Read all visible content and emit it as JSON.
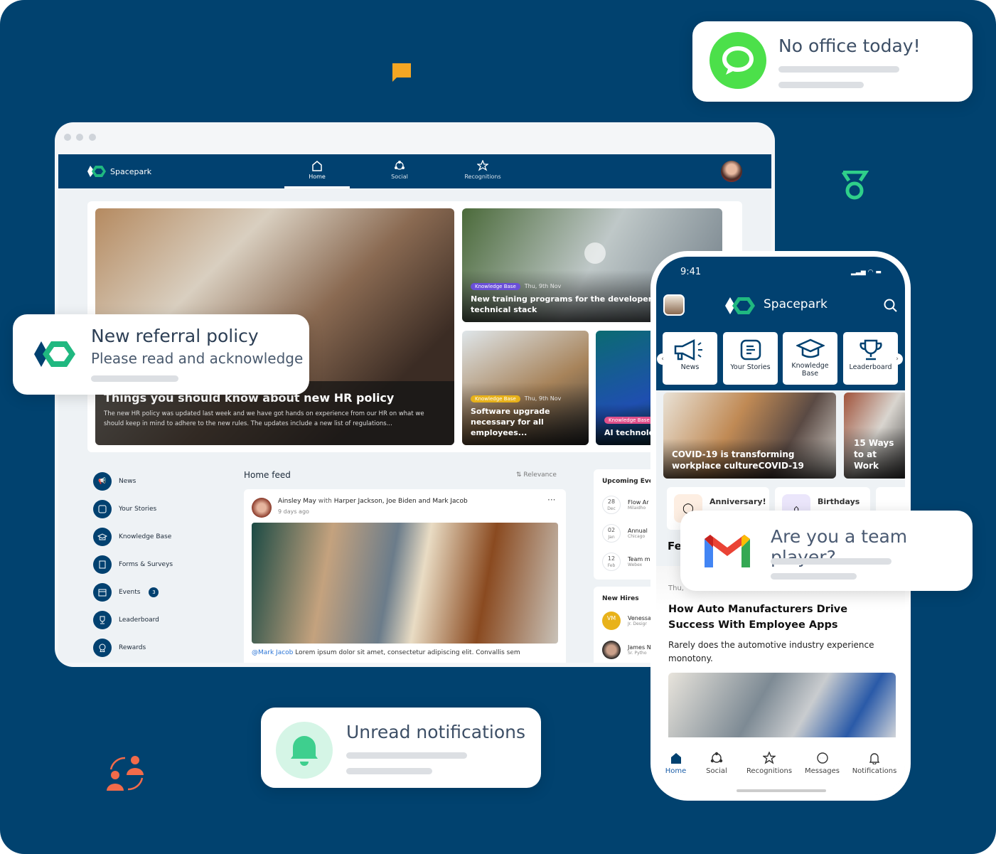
{
  "colors": {
    "background": "#01426f",
    "brand_navy": "#014170",
    "brand_green": "#20b880",
    "chat_green": "#4ce04a",
    "orange": "#f26b4a",
    "amber": "#f5a623"
  },
  "toasts": {
    "office": {
      "title": "No office today!",
      "icon": "chat-bubble-icon"
    },
    "referral": {
      "title": "New referral policy",
      "subtitle": "Please read and acknowledge",
      "icon": "spacepark-logo"
    },
    "gmail": {
      "title": "Are you a team player?",
      "icon": "gmail-icon"
    },
    "notifications": {
      "title": "Unread notifications",
      "icon": "bell-icon"
    }
  },
  "desktop": {
    "brand": "Spacepark",
    "nav": [
      {
        "label": "Home",
        "icon": "home-icon",
        "active": true
      },
      {
        "label": "Social",
        "icon": "social-icon"
      },
      {
        "label": "Recognitions",
        "icon": "star-icon"
      }
    ],
    "hero": {
      "title": "Things you should know about new HR policy",
      "body": "The new HR policy was updated last week and we have got hands on experience from our HR on what we should keep in mind to adhere to the new rules. The updates include a new list of regulations..."
    },
    "cards": [
      {
        "tag": "Knowledge Base",
        "tag_color": "#6a4fd8",
        "date": "Thu, 9th Nov",
        "title": "New training programs for the developers to e technical stack"
      },
      {
        "tag": "Knowledge Base",
        "tag_color": "#e8b21a",
        "date": "Thu, 9th Nov",
        "title": "Software upgrade necessary for all employees..."
      },
      {
        "tag": "Knowledge Base",
        "tag_color": "#e0508a",
        "title": "AI technolog watch out fo"
      }
    ],
    "sidebar": [
      {
        "label": "News",
        "icon": "megaphone-icon"
      },
      {
        "label": "Your Stories",
        "icon": "stories-icon"
      },
      {
        "label": "Knowledge Base",
        "icon": "graduation-cap-icon"
      },
      {
        "label": "Forms & Surveys",
        "icon": "form-icon"
      },
      {
        "label": "Events",
        "icon": "calendar-icon",
        "badge": "3"
      },
      {
        "label": "Leaderboard",
        "icon": "trophy-icon"
      },
      {
        "label": "Rewards",
        "icon": "award-icon"
      }
    ],
    "feed": {
      "title": "Home feed",
      "sort": "Relevance",
      "post": {
        "author": "Ainsley May",
        "with_word": "with",
        "tagged": "Harper Jackson, Joe Biden and Mark Jacob",
        "time": "9 days ago",
        "mention": "@Mark Jacob",
        "text": " Lorem ipsum dolor sit amet, consectetur adipiscing elit. Convallis sem"
      }
    },
    "events": {
      "title": "Upcoming Eve",
      "items": [
        {
          "day": "28",
          "month": "Dec",
          "name": "Flow Ar",
          "place": "Milaidho"
        },
        {
          "day": "02",
          "month": "Jan",
          "name": "Annual",
          "place": "Chicago"
        },
        {
          "day": "12",
          "month": "Feb",
          "name": "Team m",
          "place": "Webex"
        }
      ]
    },
    "hires": {
      "title": "New Hires",
      "items": [
        {
          "initials": "VM",
          "name": "Venessa",
          "role": "Jr. Desigr"
        },
        {
          "name": "James N",
          "role": "Sr. Pytho"
        }
      ]
    }
  },
  "mobile": {
    "time": "9:41",
    "brand": "Spacepark",
    "tiles": [
      {
        "label": "News",
        "icon": "megaphone-icon"
      },
      {
        "label": "Your Stories",
        "icon": "stories-icon"
      },
      {
        "label": "Knowledge Base",
        "icon": "graduation-cap-icon"
      },
      {
        "label": "Leaderboard",
        "icon": "trophy-icon"
      }
    ],
    "stories": [
      {
        "title": "COVID-19 is transforming workplace cultureCOVID-19"
      },
      {
        "title": "15 Ways to at Work"
      }
    ],
    "celebrations": [
      {
        "label": "Anniversary!",
        "icon": "balloon-icon"
      },
      {
        "label": "Birthdays",
        "icon": "cake-icon"
      }
    ],
    "section_stub": "Fe",
    "date_stub": "Thu,",
    "article": {
      "title": "How Auto Manufacturers Drive Success With Employee Apps",
      "body": "Rarely does the automotive industry experience monotony."
    },
    "bottom_nav": [
      {
        "label": "Home",
        "active": true
      },
      {
        "label": "Social"
      },
      {
        "label": "Recognitions"
      },
      {
        "label": "Messages"
      },
      {
        "label": "Notifications"
      }
    ]
  }
}
